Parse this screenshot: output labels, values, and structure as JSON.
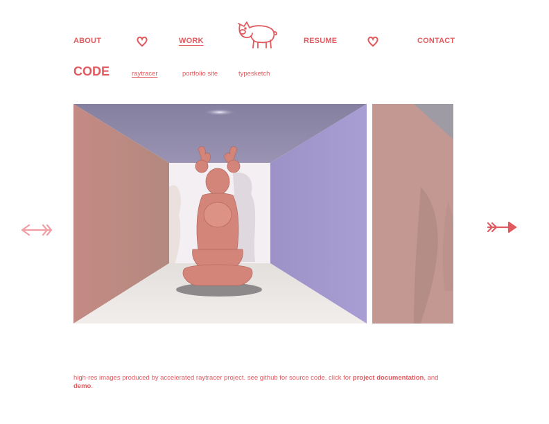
{
  "nav": {
    "about": "ABOUT",
    "work": "WORK",
    "resume": "RESUME",
    "contact": "CONTACT"
  },
  "section": {
    "title": "CODE",
    "tabs": [
      "raytracer",
      "portfolio site",
      "typesketch"
    ],
    "active_tab": "raytracer"
  },
  "caption": {
    "text": "high-res images produced by accelerated raytracer project.  see github for source code.  click for ",
    "doc_link": "project documentation",
    "middle": ", and",
    "demo_link": "demo",
    "end": "."
  },
  "colors": {
    "accent": "#e05a5f",
    "arrow_left": "#f0a0a4",
    "wall_left": "#c98a84",
    "wall_right": "#a79bd0",
    "ceiling": "#8f88ab",
    "floor": "#e8e4e2",
    "statue": "#d4857a"
  },
  "icons": [
    "pig-logo-icon",
    "heart-icon",
    "arrow-left-icon",
    "arrow-right-icon"
  ]
}
